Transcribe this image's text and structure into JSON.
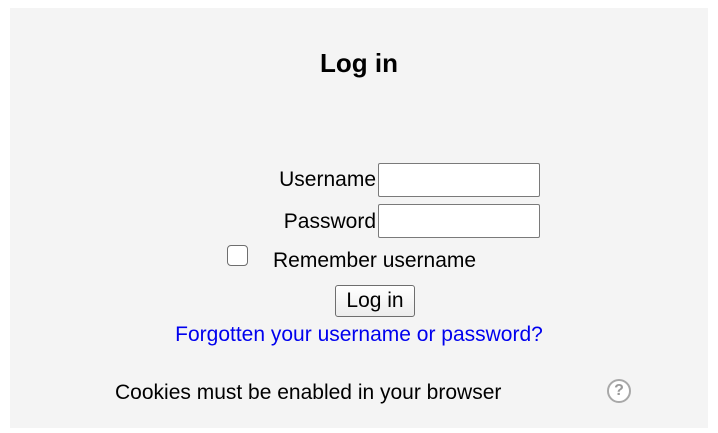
{
  "login": {
    "title": "Log in",
    "username_label": "Username",
    "username_value": "",
    "password_label": "Password",
    "password_value": "",
    "remember_label": "Remember username",
    "remember_checked": false,
    "submit_label": "Log in",
    "forgot_link": "Forgotten your username or password?",
    "cookies_note": "Cookies must be enabled in your browser",
    "help_icon": "question-mark-circle-icon"
  }
}
